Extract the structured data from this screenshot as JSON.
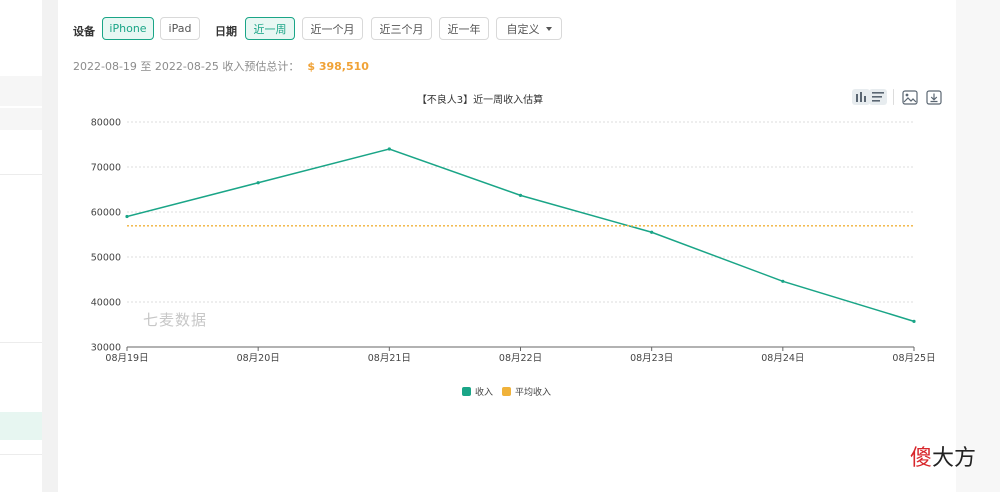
{
  "filters": {
    "device_label": "设备",
    "devices": [
      {
        "label": "iPhone",
        "active": true
      },
      {
        "label": "iPad",
        "active": false
      }
    ],
    "date_label": "日期",
    "ranges": [
      {
        "label": "近一周",
        "active": true
      },
      {
        "label": "近一个月",
        "active": false
      },
      {
        "label": "近三个月",
        "active": false
      },
      {
        "label": "近一年",
        "active": false
      },
      {
        "label": "自定义",
        "active": false
      }
    ]
  },
  "summary": {
    "text": "2022-08-19 至 2022-08-25 收入预估总计：",
    "amount": "$ 398,510"
  },
  "chart": {
    "title": "【不良人3】近一周收入估算",
    "watermark": "七麦数据",
    "toolbar_icons": [
      "bar-chart-icon",
      "list-icon",
      "image-icon",
      "download-icon"
    ]
  },
  "chart_data": {
    "type": "line",
    "title": "【不良人3】近一周收入估算",
    "categories": [
      "08月19日",
      "08月20日",
      "08月21日",
      "08月22日",
      "08月23日",
      "08月24日",
      "08月25日"
    ],
    "series": [
      {
        "name": "收入",
        "values": [
          59000,
          66500,
          74000,
          63700,
          55500,
          44600,
          35700
        ],
        "color": "#1aa587"
      },
      {
        "name": "平均收入",
        "values": [
          56930,
          56930,
          56930,
          56930,
          56930,
          56930,
          56930
        ],
        "color": "#f0b23a",
        "style": "dotted"
      }
    ],
    "yticks": [
      30000,
      40000,
      50000,
      60000,
      70000,
      80000
    ],
    "ylim": [
      30000,
      80000
    ],
    "grid": true,
    "legend": "bottom-center"
  },
  "logo": {
    "first": "傻",
    "rest": "大方"
  }
}
